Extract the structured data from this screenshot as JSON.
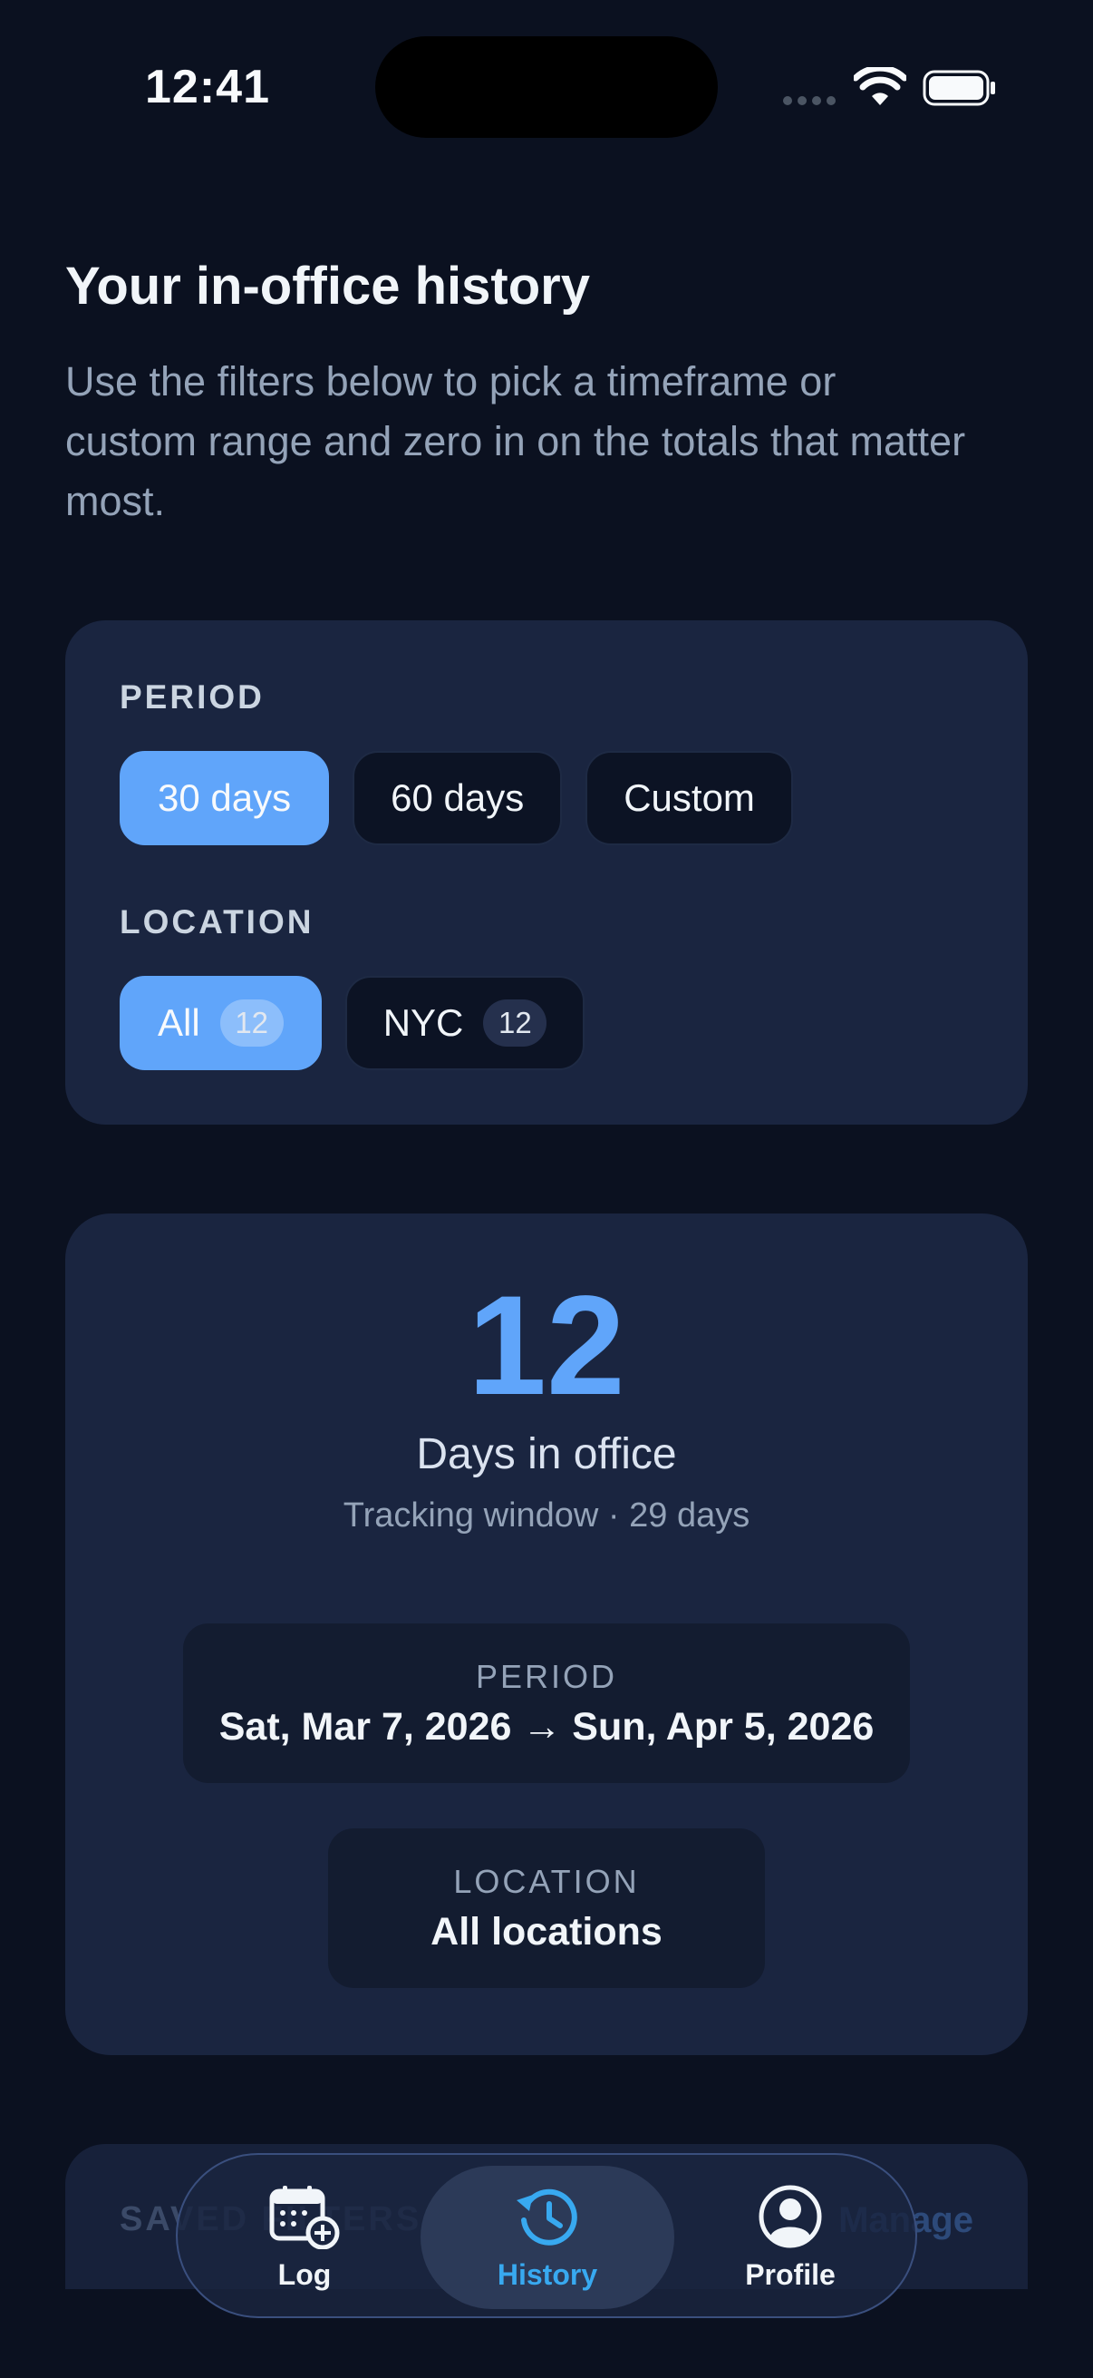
{
  "status_bar": {
    "time": "12:41"
  },
  "header": {
    "title": "Your in-office history",
    "subtitle": "Use the filters below to pick a timeframe or custom range and zero in on the totals that matter most."
  },
  "filters": {
    "period_label": "PERIOD",
    "period_options": [
      {
        "label": "30 days",
        "selected": true
      },
      {
        "label": "60 days",
        "selected": false
      },
      {
        "label": "Custom",
        "selected": false
      }
    ],
    "location_label": "LOCATION",
    "location_options": [
      {
        "label": "All",
        "count": "12",
        "selected": true
      },
      {
        "label": "NYC",
        "count": "12",
        "selected": false
      }
    ]
  },
  "summary": {
    "days_count": "12",
    "days_label": "Days in office",
    "tracking_window": "Tracking window · 29 days",
    "period_label": "PERIOD",
    "period_value": "Sat, Mar 7, 2026 → Sun, Apr 5, 2026",
    "location_label": "LOCATION",
    "location_value": "All locations"
  },
  "saved_filters": {
    "title": "SAVED FILTERS",
    "manage_label": "Manage"
  },
  "tab_bar": {
    "tabs": [
      {
        "label": "Log",
        "icon": "calendar-plus-icon",
        "active": false
      },
      {
        "label": "History",
        "icon": "history-icon",
        "active": true
      },
      {
        "label": "Profile",
        "icon": "person-circle-icon",
        "active": false
      }
    ]
  },
  "colors": {
    "background": "#0b1120",
    "card": "#1a2540",
    "accent": "#60a5fa",
    "tab_active_text": "#38a9f0"
  }
}
